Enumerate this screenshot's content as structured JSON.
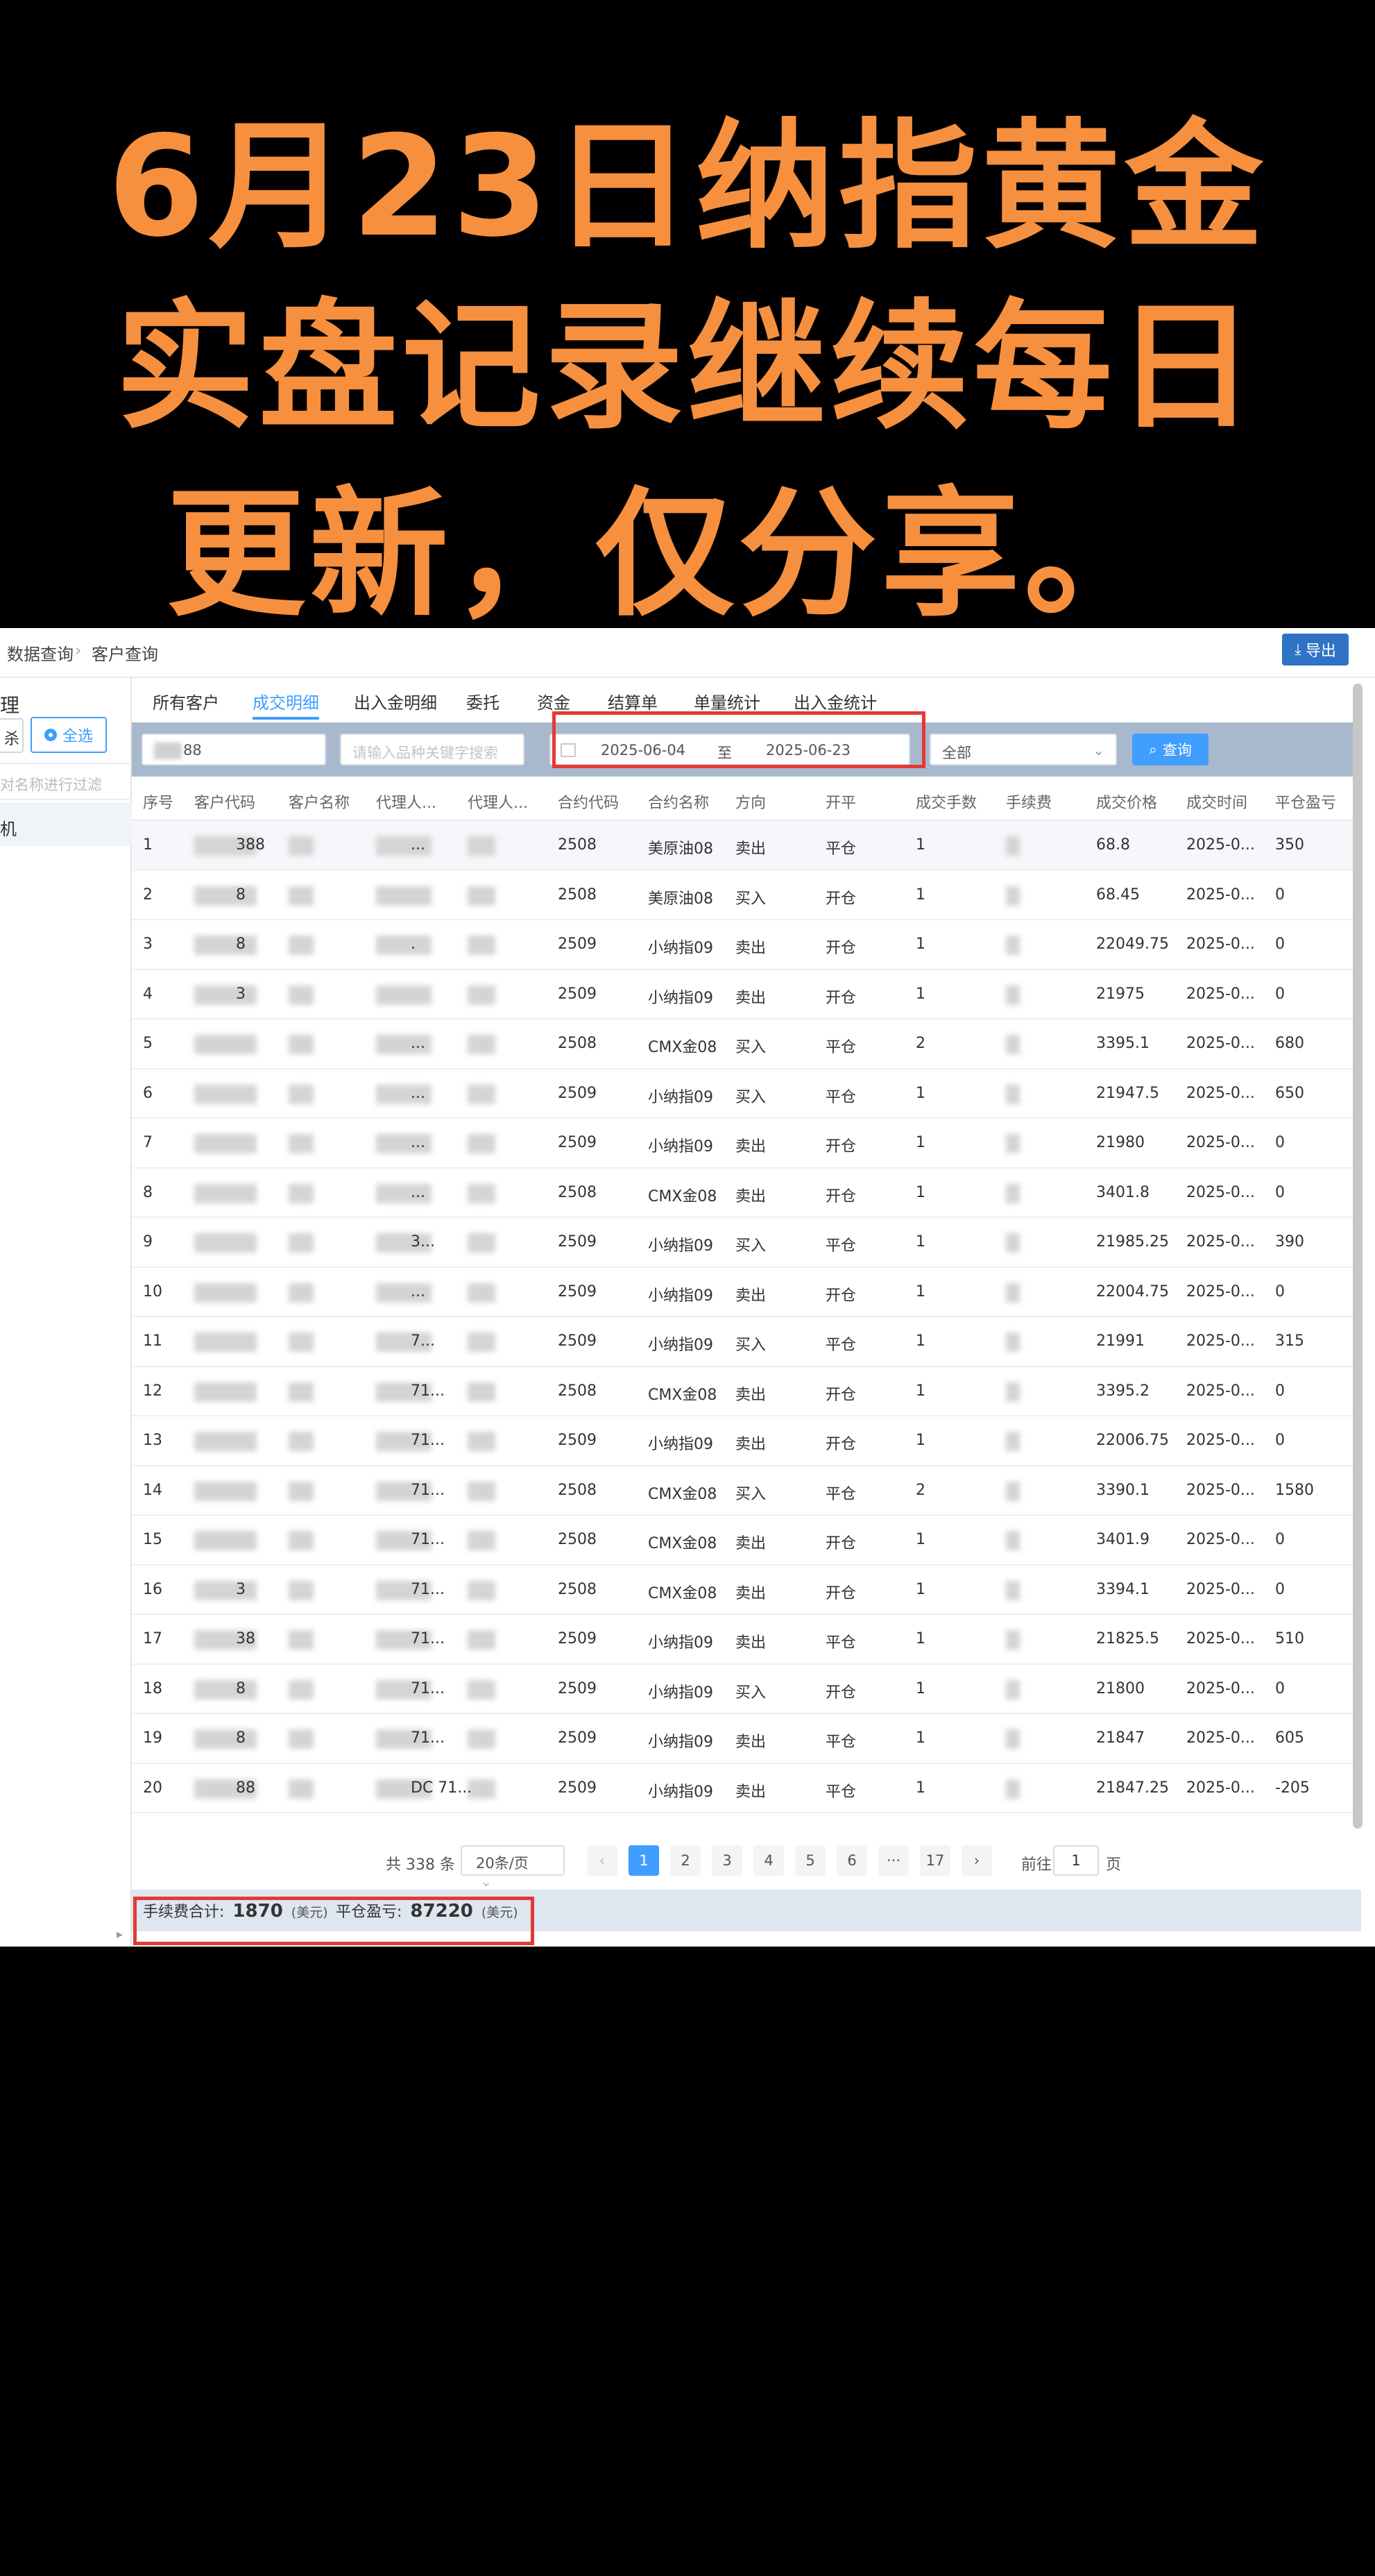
{
  "headline": {
    "line1": "6月23日纳指黄金",
    "line2": "实盘记录继续每日",
    "line3": "更新，仅分享。"
  },
  "breadcrumb": {
    "item1": "数据查询",
    "item2": "客户查询"
  },
  "toolbar": {
    "export_label": "导出"
  },
  "sidebar": {
    "title": "理",
    "btn_a": "杀",
    "select_all": "全选",
    "filter_placeholder": "对名称进行过滤",
    "item": "机"
  },
  "tabs": [
    {
      "label": "所有客户"
    },
    {
      "label": "成交明细"
    },
    {
      "label": "出入金明细"
    },
    {
      "label": "委托"
    },
    {
      "label": "资金"
    },
    {
      "label": "结算单"
    },
    {
      "label": "单量统计"
    },
    {
      "label": "出入金统计"
    }
  ],
  "filters": {
    "customer_value": "88",
    "keyword_placeholder": "请输入品种关键字搜索",
    "date_from": "2025-06-04",
    "date_to_sep": "至",
    "date_to": "2025-06-23",
    "select_value": "全部",
    "query_label": "查询"
  },
  "columns": [
    "序号",
    "客户代码",
    "客户名称",
    "代理人...",
    "代理人...",
    "合约代码",
    "合约名称",
    "方向",
    "开平",
    "成交手数",
    "手续费",
    "成交价格",
    "成交时间",
    "平仓盈亏"
  ],
  "rows": [
    {
      "no": "1",
      "cust": "388",
      "agent": "...",
      "code": "2508",
      "name": "美原油08",
      "dir": "卖出",
      "oc": "平仓",
      "qty": "1",
      "price": "68.8",
      "time": "2025-0...",
      "pnl": "350"
    },
    {
      "no": "2",
      "cust": "8",
      "agent": "",
      "code": "2508",
      "name": "美原油08",
      "dir": "买入",
      "oc": "开仓",
      "qty": "1",
      "price": "68.45",
      "time": "2025-0...",
      "pnl": "0"
    },
    {
      "no": "3",
      "cust": "8",
      "agent": ".",
      "code": "2509",
      "name": "小纳指09",
      "dir": "卖出",
      "oc": "开仓",
      "qty": "1",
      "price": "22049.75",
      "time": "2025-0...",
      "pnl": "0"
    },
    {
      "no": "4",
      "cust": "3",
      "agent": "",
      "code": "2509",
      "name": "小纳指09",
      "dir": "卖出",
      "oc": "开仓",
      "qty": "1",
      "price": "21975",
      "time": "2025-0...",
      "pnl": "0"
    },
    {
      "no": "5",
      "cust": "",
      "agent": "...",
      "code": "2508",
      "name": "CMX金08",
      "dir": "买入",
      "oc": "平仓",
      "qty": "2",
      "price": "3395.1",
      "time": "2025-0...",
      "pnl": "680"
    },
    {
      "no": "6",
      "cust": "",
      "agent": "...",
      "code": "2509",
      "name": "小纳指09",
      "dir": "买入",
      "oc": "平仓",
      "qty": "1",
      "price": "21947.5",
      "time": "2025-0...",
      "pnl": "650"
    },
    {
      "no": "7",
      "cust": "",
      "agent": "...",
      "code": "2509",
      "name": "小纳指09",
      "dir": "卖出",
      "oc": "开仓",
      "qty": "1",
      "price": "21980",
      "time": "2025-0...",
      "pnl": "0"
    },
    {
      "no": "8",
      "cust": "",
      "agent": "...",
      "code": "2508",
      "name": "CMX金08",
      "dir": "卖出",
      "oc": "开仓",
      "qty": "1",
      "price": "3401.8",
      "time": "2025-0...",
      "pnl": "0"
    },
    {
      "no": "9",
      "cust": "",
      "agent": "3...",
      "code": "2509",
      "name": "小纳指09",
      "dir": "买入",
      "oc": "平仓",
      "qty": "1",
      "price": "21985.25",
      "time": "2025-0...",
      "pnl": "390"
    },
    {
      "no": "10",
      "cust": "",
      "agent": "...",
      "code": "2509",
      "name": "小纳指09",
      "dir": "卖出",
      "oc": "开仓",
      "qty": "1",
      "price": "22004.75",
      "time": "2025-0...",
      "pnl": "0"
    },
    {
      "no": "11",
      "cust": "",
      "agent": "7...",
      "code": "2509",
      "name": "小纳指09",
      "dir": "买入",
      "oc": "平仓",
      "qty": "1",
      "price": "21991",
      "time": "2025-0...",
      "pnl": "315"
    },
    {
      "no": "12",
      "cust": "",
      "agent": "71...",
      "code": "2508",
      "name": "CMX金08",
      "dir": "卖出",
      "oc": "开仓",
      "qty": "1",
      "price": "3395.2",
      "time": "2025-0...",
      "pnl": "0"
    },
    {
      "no": "13",
      "cust": "",
      "agent": "71...",
      "code": "2509",
      "name": "小纳指09",
      "dir": "卖出",
      "oc": "开仓",
      "qty": "1",
      "price": "22006.75",
      "time": "2025-0...",
      "pnl": "0"
    },
    {
      "no": "14",
      "cust": "",
      "agent": "71...",
      "code": "2508",
      "name": "CMX金08",
      "dir": "买入",
      "oc": "平仓",
      "qty": "2",
      "price": "3390.1",
      "time": "2025-0...",
      "pnl": "1580"
    },
    {
      "no": "15",
      "cust": "",
      "agent": "71...",
      "code": "2508",
      "name": "CMX金08",
      "dir": "卖出",
      "oc": "开仓",
      "qty": "1",
      "price": "3401.9",
      "time": "2025-0...",
      "pnl": "0"
    },
    {
      "no": "16",
      "cust": "3",
      "agent": "71...",
      "code": "2508",
      "name": "CMX金08",
      "dir": "卖出",
      "oc": "开仓",
      "qty": "1",
      "price": "3394.1",
      "time": "2025-0...",
      "pnl": "0"
    },
    {
      "no": "17",
      "cust": "38",
      "agent": "71...",
      "code": "2509",
      "name": "小纳指09",
      "dir": "卖出",
      "oc": "平仓",
      "qty": "1",
      "price": "21825.5",
      "time": "2025-0...",
      "pnl": "510"
    },
    {
      "no": "18",
      "cust": "8",
      "agent": "71...",
      "code": "2509",
      "name": "小纳指09",
      "dir": "买入",
      "oc": "开仓",
      "qty": "1",
      "price": "21800",
      "time": "2025-0...",
      "pnl": "0"
    },
    {
      "no": "19",
      "cust": "8",
      "agent": "71...",
      "code": "2509",
      "name": "小纳指09",
      "dir": "卖出",
      "oc": "平仓",
      "qty": "1",
      "price": "21847",
      "time": "2025-0...",
      "pnl": "605"
    },
    {
      "no": "20",
      "cust": "88",
      "agent": "DC 71...",
      "code": "2509",
      "name": "小纳指09",
      "dir": "卖出",
      "oc": "平仓",
      "qty": "1",
      "price": "21847.25",
      "time": "2025-0...",
      "pnl": "-205"
    }
  ],
  "pagination": {
    "total": "共 338 条",
    "page_size": "20条/页",
    "pages": [
      "1",
      "2",
      "3",
      "4",
      "5",
      "6",
      "17"
    ],
    "ellipsis": "···",
    "current": "1",
    "goto_label": "前往",
    "goto_value": "1",
    "goto_suffix": "页"
  },
  "summary": {
    "fee_label": "手续费合计:",
    "fee_value": "1870",
    "fee_unit": "(美元)",
    "pnl_label": "平仓盈亏:",
    "pnl_value": "87220",
    "pnl_unit": "(美元)"
  },
  "colors": {
    "headline": "#f6903f",
    "accent": "#409eff",
    "highlight_box": "#e53935",
    "filter_bar": "#a9b9cd"
  }
}
